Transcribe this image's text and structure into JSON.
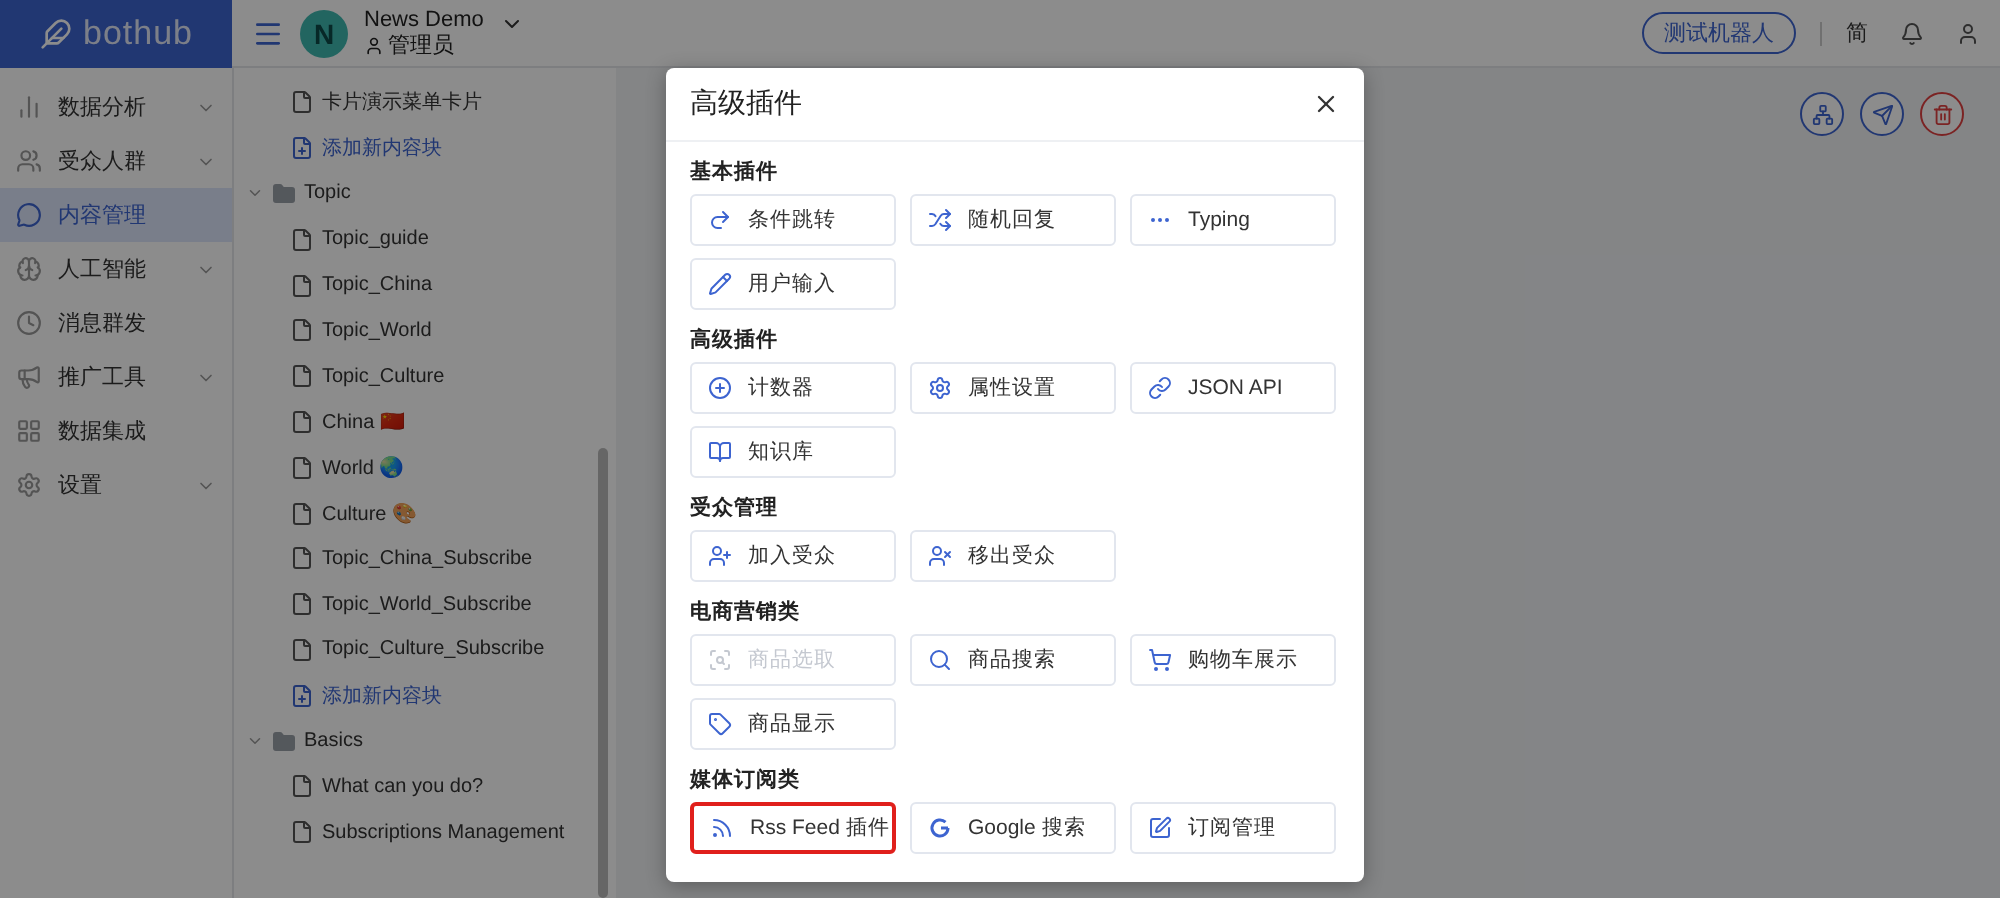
{
  "brand": {
    "name": "bothub"
  },
  "header": {
    "avatar": "N",
    "project": "News Demo",
    "role": "管理员",
    "test_button": "测试机器人",
    "language": "简"
  },
  "sidebar": {
    "items": [
      {
        "label": "数据分析",
        "has_submenu": true,
        "selected": false
      },
      {
        "label": "受众人群",
        "has_submenu": true,
        "selected": false
      },
      {
        "label": "内容管理",
        "has_submenu": false,
        "selected": true
      },
      {
        "label": "人工智能",
        "has_submenu": true,
        "selected": false
      },
      {
        "label": "消息群发",
        "has_submenu": false,
        "selected": false
      },
      {
        "label": "推广工具",
        "has_submenu": true,
        "selected": false
      },
      {
        "label": "数据集成",
        "has_submenu": false,
        "selected": false
      },
      {
        "label": "设置",
        "has_submenu": true,
        "selected": false
      }
    ]
  },
  "tree": [
    {
      "kind": "file",
      "label": "卡片演示菜单卡片"
    },
    {
      "kind": "add",
      "label": "添加新内容块"
    },
    {
      "kind": "folder",
      "label": "Topic",
      "expanded": true,
      "children": [
        {
          "kind": "file",
          "label": "Topic_guide"
        },
        {
          "kind": "file",
          "label": "Topic_China"
        },
        {
          "kind": "file",
          "label": "Topic_World"
        },
        {
          "kind": "file",
          "label": "Topic_Culture"
        },
        {
          "kind": "file",
          "label": "China 🇨🇳"
        },
        {
          "kind": "file",
          "label": "World 🌏"
        },
        {
          "kind": "file",
          "label": "Culture 🎨"
        },
        {
          "kind": "file",
          "label": "Topic_China_Subscribe"
        },
        {
          "kind": "file",
          "label": "Topic_World_Subscribe"
        },
        {
          "kind": "file",
          "label": "Topic_Culture_Subscribe"
        },
        {
          "kind": "add",
          "label": "添加新内容块"
        }
      ]
    },
    {
      "kind": "folder",
      "label": "Basics",
      "expanded": true,
      "children": [
        {
          "kind": "file",
          "label": "What can you do?"
        },
        {
          "kind": "file",
          "label": "Subscriptions Management"
        }
      ]
    }
  ],
  "dialog": {
    "title": "高级插件",
    "sections": [
      {
        "title": "基本插件",
        "items": [
          {
            "label": "条件跳转",
            "disabled": false,
            "highlighted": false
          },
          {
            "label": "随机回复",
            "disabled": false,
            "highlighted": false
          },
          {
            "label": "Typing",
            "disabled": false,
            "highlighted": false
          },
          {
            "label": "用户输入",
            "disabled": false,
            "highlighted": false
          }
        ]
      },
      {
        "title": "高级插件",
        "items": [
          {
            "label": "计数器",
            "disabled": false,
            "highlighted": false
          },
          {
            "label": "属性设置",
            "disabled": false,
            "highlighted": false
          },
          {
            "label": "JSON API",
            "disabled": false,
            "highlighted": false
          },
          {
            "label": "知识库",
            "disabled": false,
            "highlighted": false
          }
        ]
      },
      {
        "title": "受众管理",
        "items": [
          {
            "label": "加入受众",
            "disabled": false,
            "highlighted": false
          },
          {
            "label": "移出受众",
            "disabled": false,
            "highlighted": false
          }
        ]
      },
      {
        "title": "电商营销类",
        "items": [
          {
            "label": "商品选取",
            "disabled": true,
            "highlighted": false
          },
          {
            "label": "商品搜索",
            "disabled": false,
            "highlighted": false
          },
          {
            "label": "购物车展示",
            "disabled": false,
            "highlighted": false
          },
          {
            "label": "商品显示",
            "disabled": false,
            "highlighted": false
          }
        ]
      },
      {
        "title": "媒体订阅类",
        "items": [
          {
            "label": "Rss Feed 插件",
            "disabled": false,
            "highlighted": true
          },
          {
            "label": "Google 搜索",
            "disabled": false,
            "highlighted": false
          },
          {
            "label": "订阅管理",
            "disabled": false,
            "highlighted": false
          }
        ]
      }
    ]
  }
}
